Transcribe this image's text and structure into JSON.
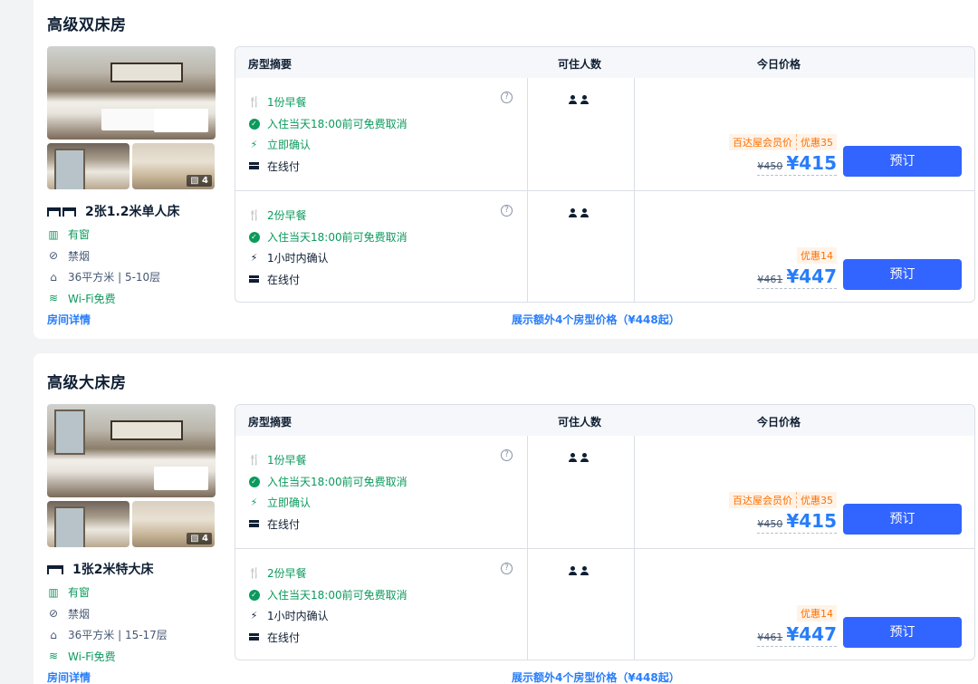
{
  "rooms": [
    {
      "name": "高级双床房",
      "photo_count": "4",
      "bed": "2张1.2米单人床",
      "bed_icon": "twin-bed-icon",
      "attrs": [
        {
          "text": "有窗",
          "icon": "window-icon"
        },
        {
          "text": "禁烟",
          "icon": "no-smoking-icon"
        },
        {
          "text": "36平方米 | 5-10层",
          "icon": "area-icon"
        },
        {
          "text": "Wi-Fi免费",
          "icon": "wifi-icon"
        }
      ],
      "detail_link": "房间详情",
      "table": {
        "headers": [
          "房型摘要",
          "可住人数",
          "今日价格"
        ],
        "rows": [
          {
            "breakfast": "1份早餐",
            "cancel": "入住当天18:00前可免费取消",
            "confirm": "立即确认",
            "payment": "在线付",
            "guests": 2,
            "tag_member": "百达屋会员价",
            "tag_discount": "优惠35",
            "orig_price": "¥450",
            "price": "¥415",
            "book": "预订"
          },
          {
            "breakfast": "2份早餐",
            "cancel": "入住当天18:00前可免费取消",
            "confirm": "1小时内确认",
            "payment": "在线付",
            "guests": 2,
            "tag_member": "",
            "tag_discount": "优惠14",
            "orig_price": "¥461",
            "price": "¥447",
            "book": "预订"
          }
        ]
      },
      "more_link": "展示额外4个房型价格（¥448起）"
    },
    {
      "name": "高级大床房",
      "photo_count": "4",
      "bed": "1张2米特大床",
      "bed_icon": "king-bed-icon",
      "attrs": [
        {
          "text": "有窗",
          "icon": "window-icon"
        },
        {
          "text": "禁烟",
          "icon": "no-smoking-icon"
        },
        {
          "text": "36平方米 | 15-17层",
          "icon": "area-icon"
        },
        {
          "text": "Wi-Fi免费",
          "icon": "wifi-icon"
        }
      ],
      "detail_link": "房间详情",
      "table": {
        "headers": [
          "房型摘要",
          "可住人数",
          "今日价格"
        ],
        "rows": [
          {
            "breakfast": "1份早餐",
            "cancel": "入住当天18:00前可免费取消",
            "confirm": "立即确认",
            "payment": "在线付",
            "guests": 2,
            "tag_member": "百达屋会员价",
            "tag_discount": "优惠35",
            "orig_price": "¥450",
            "price": "¥415",
            "book": "预订"
          },
          {
            "breakfast": "2份早餐",
            "cancel": "入住当天18:00前可免费取消",
            "confirm": "1小时内确认",
            "payment": "在线付",
            "guests": 2,
            "tag_member": "",
            "tag_discount": "优惠14",
            "orig_price": "¥461",
            "price": "¥447",
            "book": "预订"
          }
        ]
      },
      "more_link": "展示额外4个房型价格（¥448起）"
    }
  ],
  "colors": {
    "accent": "#287dfa",
    "button": "#3264ff",
    "green": "#0b9a5c",
    "orange": "#ff6f00"
  }
}
